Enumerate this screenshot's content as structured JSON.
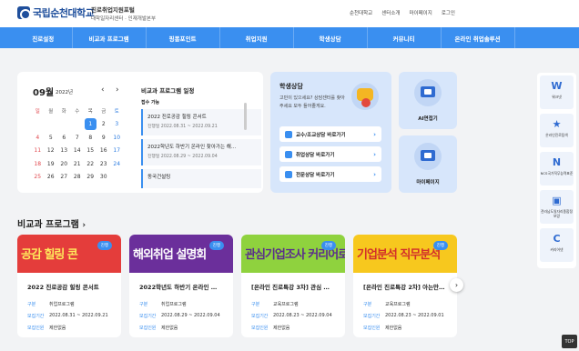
{
  "header": {
    "logo_text": "국립순천대학교",
    "site_title": "진로취업지원포털",
    "site_sub": "대학일자리센터 · 인재개발본부",
    "util_links": [
      "순천대학교",
      "센터소개",
      "마이페이지",
      "로그인"
    ]
  },
  "gnb": [
    "진로설정",
    "비교과 프로그램",
    "핑퐁포인트",
    "취업지원",
    "학생상담",
    "커뮤니티",
    "온라인 취업솔루션"
  ],
  "calendar": {
    "month": "09월",
    "year": "2022년",
    "prev": "‹",
    "next": "›",
    "weekdays": [
      "일",
      "월",
      "화",
      "수",
      "목",
      "금",
      "토"
    ],
    "weeks": [
      [
        "",
        "",
        "",
        "",
        "1",
        "2",
        "3"
      ],
      [
        "4",
        "5",
        "6",
        "7",
        "8",
        "9",
        "10"
      ],
      [
        "11",
        "12",
        "13",
        "14",
        "15",
        "16",
        "17"
      ],
      [
        "18",
        "19",
        "20",
        "21",
        "22",
        "23",
        "24"
      ],
      [
        "25",
        "26",
        "27",
        "28",
        "29",
        "30",
        ""
      ]
    ],
    "today": "1"
  },
  "schedule": {
    "title": "비교과 프로그램 일정",
    "label": "접수 가능",
    "items": [
      {
        "title": "2022 진로공감 힐링 콘서트",
        "date": "진행일 2022.08.31 ~ 2022.09.21"
      },
      {
        "title": "2022학년도 하반기 온라인 찾아가는 해…",
        "date": "진행일 2022.08.29 ~ 2022.09.04"
      },
      {
        "title": "동국건설팅",
        "date": ""
      }
    ]
  },
  "counsel": {
    "title": "학생상담",
    "desc": "고민이 있으세요? 상담센터를 찾아주세요 모두 들어줄게요.",
    "buttons": [
      "교수/조교상담 바로가기",
      "취업상담 바로가기",
      "전문상담 바로가기"
    ]
  },
  "tiles": {
    "ai": "AI면접기",
    "mypage": "마이페이지"
  },
  "quick": [
    {
      "icon": "W",
      "label": "워크넷"
    },
    {
      "icon": "★",
      "label": "온라인진로탐색"
    },
    {
      "icon": "N",
      "label": "NCS국가직무능력표준"
    },
    {
      "icon": "▣",
      "label": "전라남도일자리종합정보망"
    },
    {
      "icon": "C",
      "label": "커리어넷"
    }
  ],
  "top_label": "TOP",
  "section": {
    "title": "비교과 프로그램",
    "chevron": "›",
    "next": "›"
  },
  "meta_keys": {
    "type": "구분",
    "period": "모집기간",
    "limit": "모집인원"
  },
  "cards": [
    {
      "badge": "진행",
      "banner": "공감 힐링 콘",
      "title": "2022 진로공감 힐링 콘서트",
      "type": "취업프로그램",
      "period": "2022.08.31 ~ 2022.09.21",
      "limit": "제한없음",
      "bg": "#e43d3b",
      "fg": "#ffe95c"
    },
    {
      "badge": "진행",
      "banner": "해외취업 설명회",
      "title": "2022학년도 하반기 온라인 …",
      "type": "취업프로그램",
      "period": "2022.08.29 ~ 2022.09.04",
      "limit": "제한없음",
      "bg": "#6b2f9b",
      "fg": "#ffffff"
    },
    {
      "badge": "진행",
      "banner": "관심기업조사 커리어로드맵",
      "title": "[온라인 진로특강 3차] 관심 …",
      "type": "교육프로그램",
      "period": "2022.08.23 ~ 2022.09.04",
      "limit": "제한없음",
      "bg": "#8fd23e",
      "fg": "#5a2d8c"
    },
    {
      "badge": "진행",
      "banner": "기업분석 직무분석",
      "title": "[온라인 진로특강 2차] 아는만…",
      "type": "교육프로그램",
      "period": "2022.08.23 ~ 2022.09.01",
      "limit": "제한없음",
      "bg": "#f7c81e",
      "fg": "#d22f2a"
    }
  ]
}
